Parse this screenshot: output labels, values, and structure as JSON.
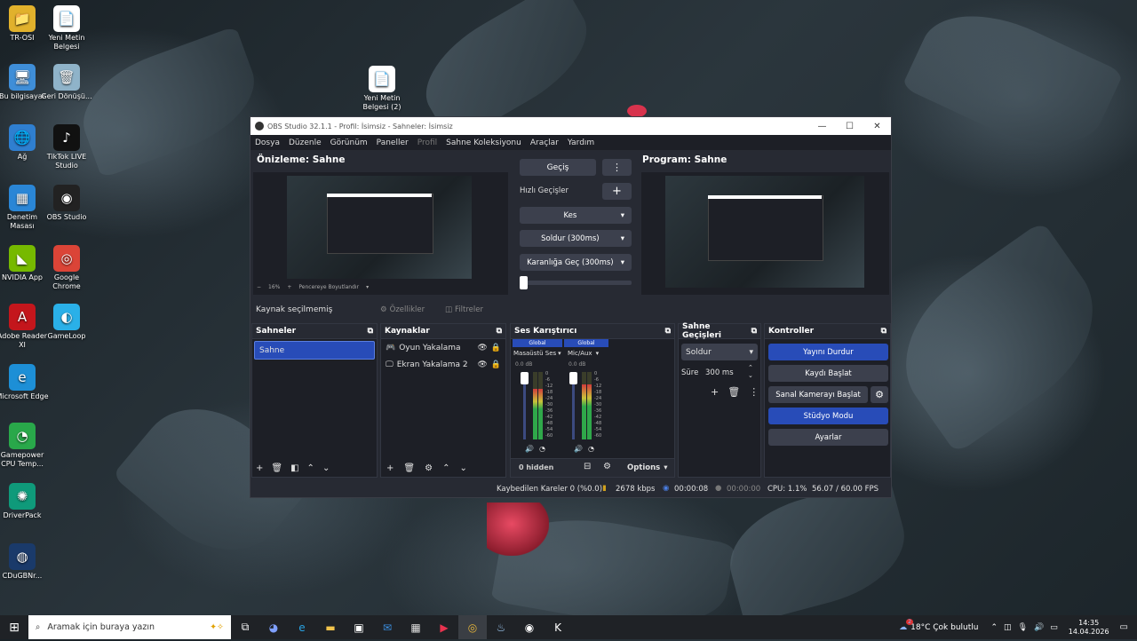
{
  "desktop": {
    "icons": [
      {
        "label": "TR-OSI",
        "glyph": "📁",
        "color": "#e1b12c"
      },
      {
        "label": "Yeni Metin Belgesi",
        "glyph": "📄",
        "color": "#ffffff"
      },
      {
        "label": "Bu bilgisayar",
        "glyph": "🖥",
        "color": "#3f8ed8"
      },
      {
        "label": "Geri Dönüşü...",
        "glyph": "🗑",
        "color": "#8fb3c9"
      },
      {
        "label": "Ağ",
        "glyph": "🌐",
        "color": "#2f7fd0"
      },
      {
        "label": "TikTok LIVE Studio",
        "glyph": "♪",
        "color": "#111111"
      },
      {
        "label": "Denetim Masası",
        "glyph": "▦",
        "color": "#2a86d6"
      },
      {
        "label": "OBS Studio",
        "glyph": "◉",
        "color": "#222222"
      },
      {
        "label": "NVIDIA App",
        "glyph": "◣",
        "color": "#76b900"
      },
      {
        "label": "Google Chrome",
        "glyph": "◎",
        "color": "#db4437"
      },
      {
        "label": "Adobe Reader XI",
        "glyph": "A",
        "color": "#c4161c"
      },
      {
        "label": "GameLoop",
        "glyph": "◐",
        "color": "#2ab0e8"
      },
      {
        "label": "Microsoft Edge",
        "glyph": "e",
        "color": "#1d8fd6"
      },
      {
        "label": "Gamepower CPU Temp...",
        "glyph": "◔",
        "color": "#29a84a"
      },
      {
        "label": "DriverPack",
        "glyph": "✺",
        "color": "#0f9a7a"
      },
      {
        "label": "CDuGBNr...",
        "glyph": "◍",
        "color": "#1a3a6a"
      },
      {
        "label": "Yeni Metin Belgesi (2)",
        "glyph": "📄",
        "color": "#ffffff"
      }
    ]
  },
  "obs": {
    "title": "OBS Studio 32.1.1 - Profil: İsimsiz - Sahneler: İsimsiz",
    "menu": [
      "Dosya",
      "Düzenle",
      "Görünüm",
      "Paneller",
      "Profil",
      "Sahne Koleksiyonu",
      "Araçlar",
      "Yardım"
    ],
    "preview_title": "Önizleme: Sahne",
    "program_title": "Program: Sahne",
    "preview_footer": {
      "zoom": "16%",
      "fit": "Pencereye Boyutlandır"
    },
    "transitions": {
      "gecis": "Geçiş",
      "quick": "Hızlı Geçişler",
      "items": [
        "Kes",
        "Soldur (300ms)",
        "Karanlığa Geç (300ms)"
      ]
    },
    "source_bar": {
      "status": "Kaynak seçilmemiş",
      "properties": "Özellikler",
      "filters": "Filtreler"
    },
    "scenes": {
      "title": "Sahneler",
      "items": [
        "Sahne"
      ]
    },
    "sources": {
      "title": "Kaynaklar",
      "items": [
        "Oyun Yakalama",
        "Ekran Yakalama 2"
      ]
    },
    "mixer": {
      "title": "Ses Karıştırıcı",
      "channels": [
        {
          "badge": "Global",
          "name": "Masaüstü Ses",
          "db": "0.0 dB",
          "level": 0.75
        },
        {
          "badge": "Global",
          "name": "Mic/Aux",
          "db": "0.0 dB",
          "level": 0.82
        }
      ],
      "scale": [
        "0",
        "-6",
        "-12",
        "-18",
        "-24",
        "-30",
        "-36",
        "-42",
        "-48",
        "-54",
        "-60"
      ],
      "hidden": "0 hidden",
      "options": "Options"
    },
    "scene_transitions": {
      "title": "Sahne Geçişleri",
      "type": "Soldur",
      "duration_label": "Süre",
      "duration": "300 ms"
    },
    "controls": {
      "title": "Kontroller",
      "buttons": [
        "Yayını Durdur",
        "Kaydı Başlat",
        "Sanal Kamerayı Başlat",
        "Stüdyo Modu",
        "Ayarlar"
      ]
    },
    "status": {
      "dropped": "Kaybedilen Kareler 0 (%0.0)",
      "bitrate": "2678 kbps",
      "stream_time": "00:00:08",
      "rec_time": "00:00:00",
      "cpu": "CPU: 1.1%",
      "fps": "56.07 / 60.00 FPS"
    }
  },
  "taskbar": {
    "search_placeholder": "Aramak için buraya yazın",
    "weather": "18°C  Çok bulutlu",
    "weather_badge": "2",
    "time": "14:35",
    "date": "14.04.2026"
  }
}
